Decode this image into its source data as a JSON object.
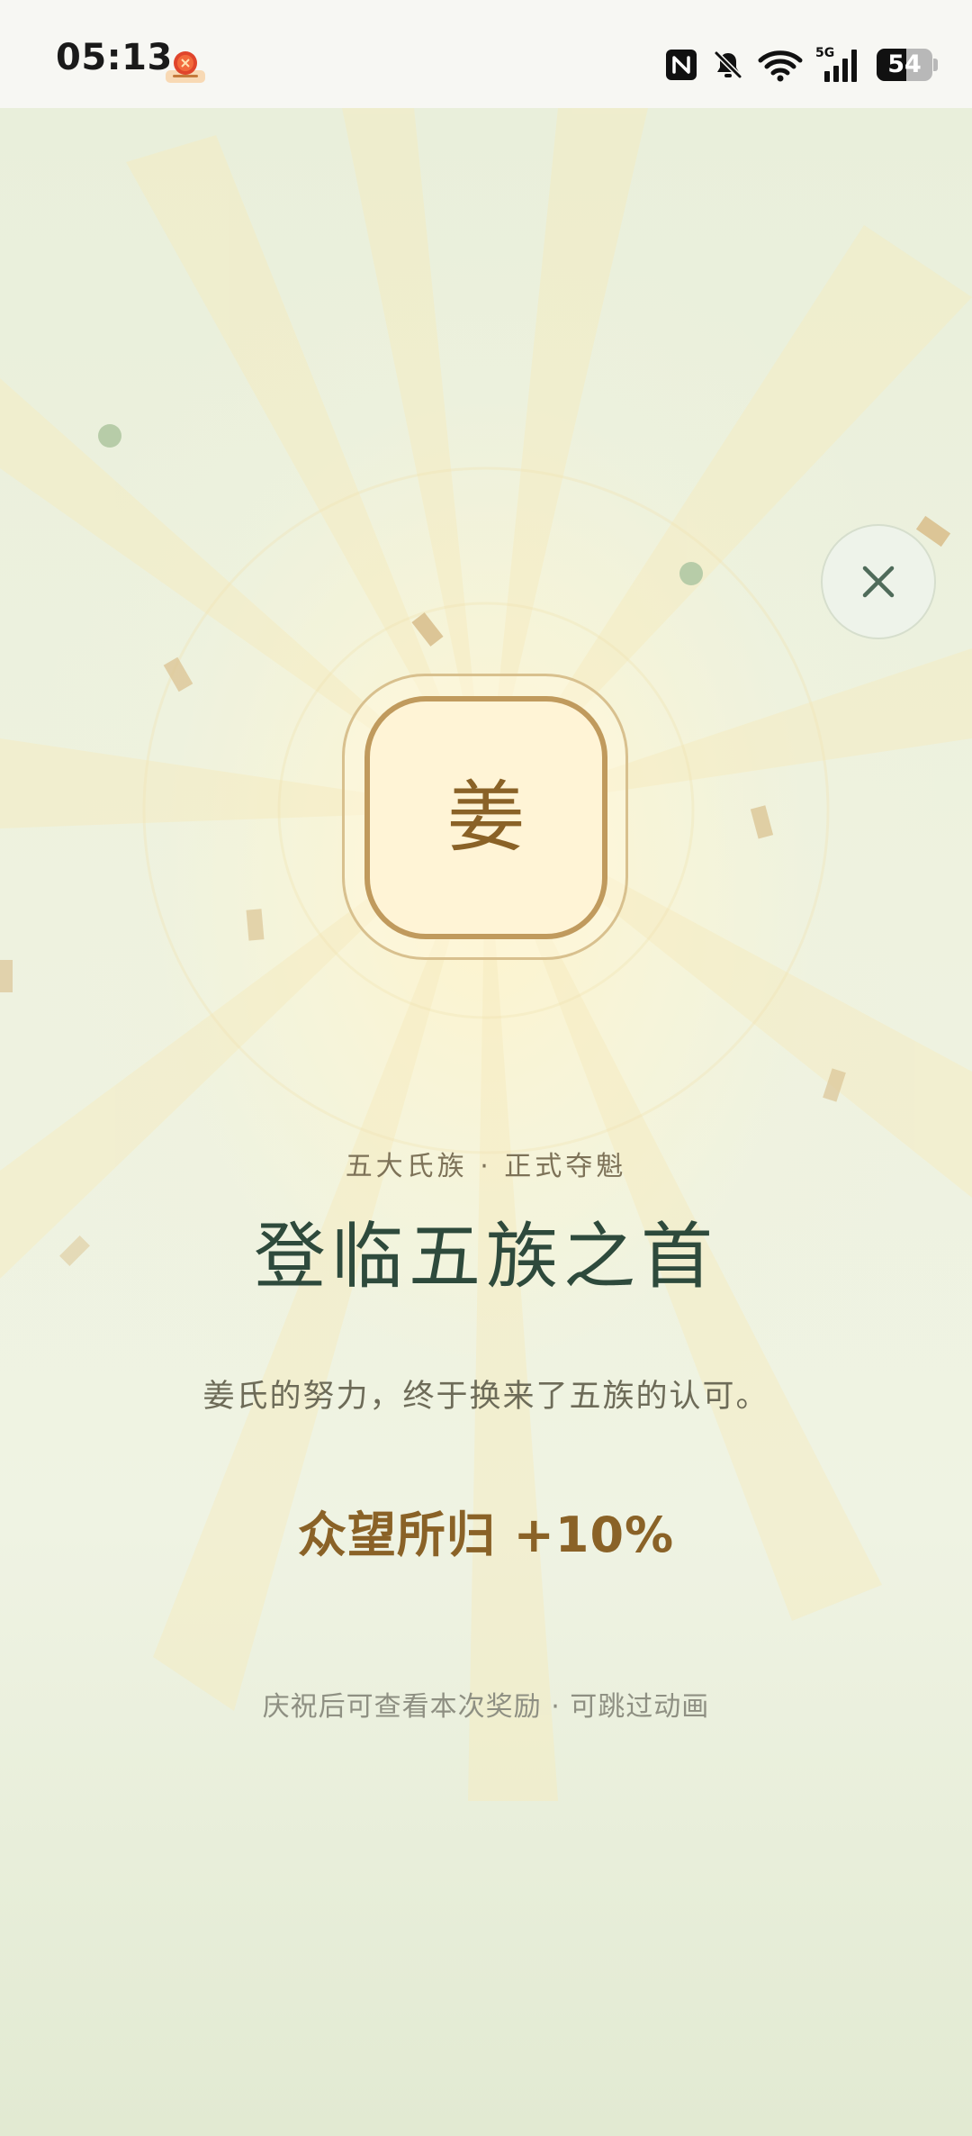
{
  "status_bar": {
    "time": "05:13",
    "battery_level": "54",
    "battery_fraction": 0.54,
    "network_label": "5G",
    "icons": [
      "app-notification-icon",
      "nfc-icon",
      "bell-muted-icon",
      "wifi-icon",
      "signal-5g-icon",
      "battery-icon"
    ]
  },
  "celebration": {
    "emblem_char": "姜",
    "kicker": "五大氏族 · 正式夺魁",
    "headline": "登临五族之首",
    "description": "姜氏的努力，终于换来了五族的认可。",
    "bonus": "众望所归 +10%",
    "hint": "庆祝后可查看本次奖励 · 可跳过动画",
    "close_icon": "close-icon"
  },
  "colors": {
    "accent_gold": "#8a6227",
    "headline_green": "#2e4a3c",
    "background": "#eef2e2"
  }
}
